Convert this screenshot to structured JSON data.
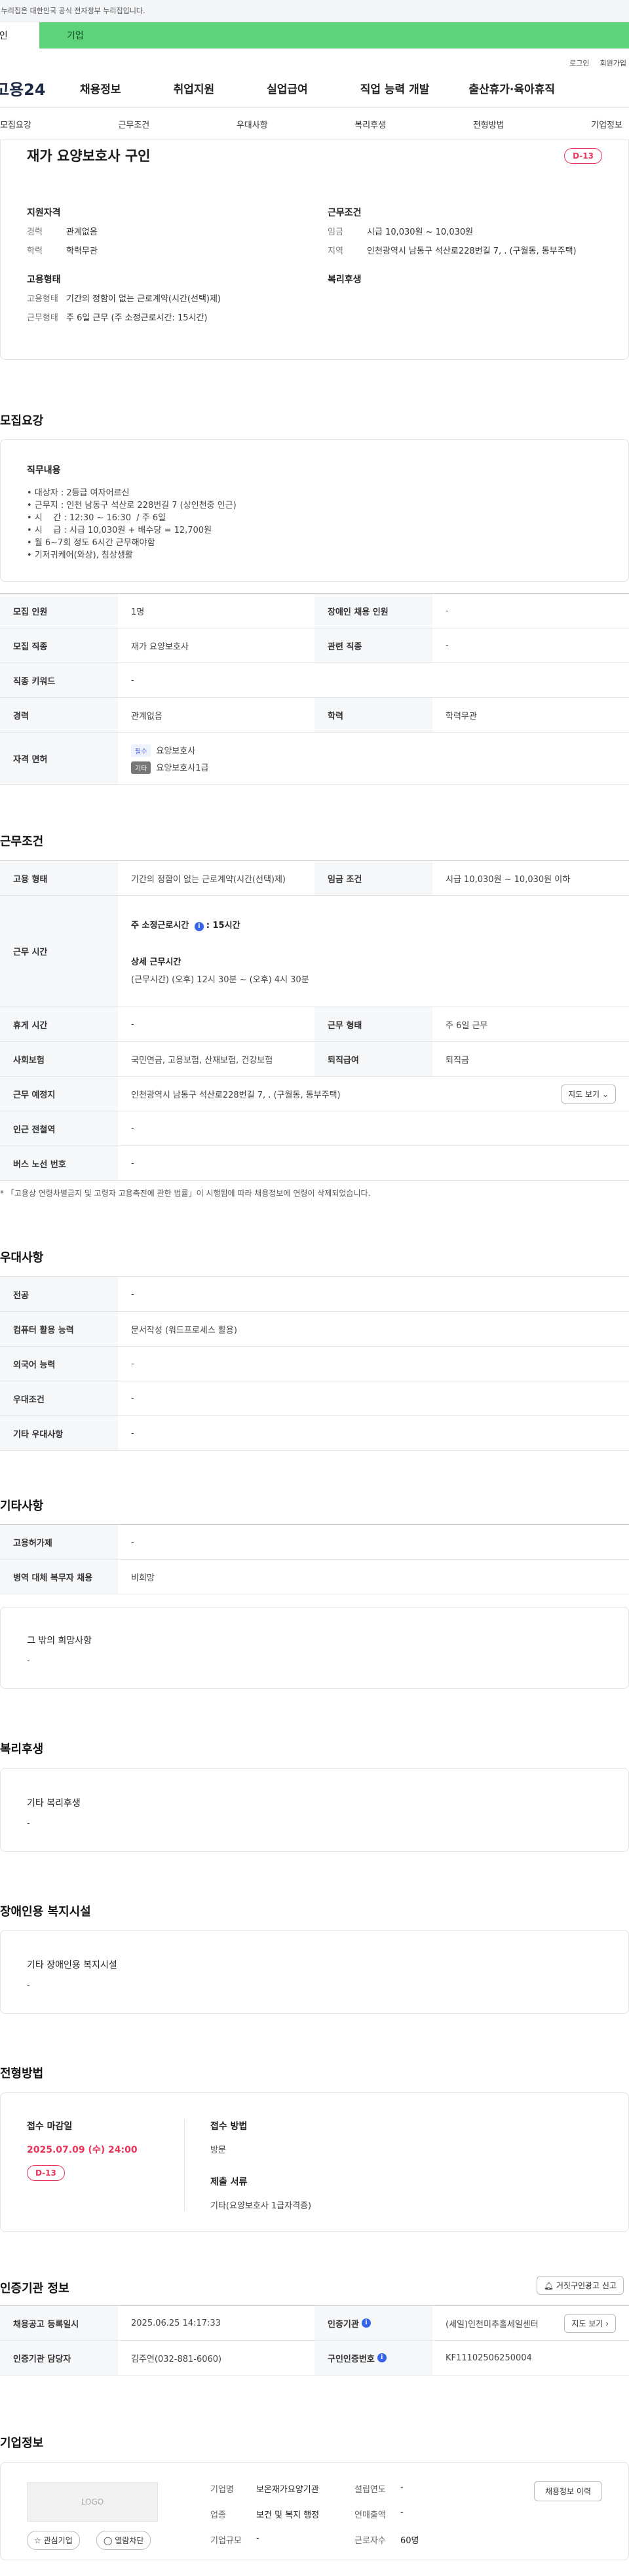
{
  "gov_notice": "이 누리집은 대한민국 공식 전자정부 누리집입니다.",
  "user_tabs": {
    "personal": "개인",
    "company": "기업"
  },
  "util_links": {
    "login": "로그인",
    "signup": "회원가입"
  },
  "logo": "고용24",
  "gnb": [
    "채용정보",
    "취업지원",
    "실업급여",
    "직업 능력 개발",
    "출산휴가·육아휴직"
  ],
  "anchor_tabs": [
    "모집요강",
    "근무조건",
    "우대사항",
    "복리후생",
    "전형방법",
    "기업정보"
  ],
  "summary": {
    "title": "재가 요양보호사 구인",
    "dday": "D-13",
    "qualification": {
      "heading": "지원자격",
      "rows": [
        {
          "k": "경력",
          "v": "관계없음"
        },
        {
          "k": "학력",
          "v": "학력무관"
        }
      ]
    },
    "conditions": {
      "heading": "근무조건",
      "rows": [
        {
          "k": "임금",
          "v": "시급 10,030원 ~ 10,030원"
        },
        {
          "k": "지역",
          "v": "인천광역시 남동구 석산로228번길 7, . (구월동, 동부주택)"
        }
      ]
    },
    "employment": {
      "heading": "고용형태",
      "rows": [
        {
          "k": "고용형태",
          "v": "기간의 정함이 없는 근로계약(시간(선택)제)"
        },
        {
          "k": "근무형태",
          "v": "주 6일 근무 (주 소정근로시간: 15시간)"
        }
      ]
    },
    "welfare": {
      "heading": "복리후생"
    }
  },
  "recruit": {
    "title": "모집요강",
    "duty_heading": "직무내용",
    "duty_lines": [
      "• 대상자 : 2등급 여자어르신",
      "• 근무지 : 인천 남동구 석산로 228번길 7 (상인천중 인근)",
      "• 시    간 : 12:30 ~ 16:30  / 주 6일",
      "• 시    급 : 시급 10,030원 + 배수당 = 12,700원",
      "• 월 6~7회 정도 6시간 근무해야함",
      "• 기저귀케어(와상), 침상생활"
    ],
    "table": {
      "headcount_label": "모집 인원",
      "headcount": "1명",
      "disabled_label": "장애인 채용 인원",
      "disabled": "-",
      "job_label": "모집 직종",
      "job": "재가 요양보호사",
      "related_label": "관련 직종",
      "related": "-",
      "keyword_label": "직종 키워드",
      "keyword": "-",
      "career_label": "경력",
      "career": "관계없음",
      "edu_label": "학력",
      "edu": "학력무관",
      "license_label": "자격 면허",
      "licenses": [
        {
          "tag": "필수",
          "name": "요양보호사"
        },
        {
          "tag": "기타",
          "name": "요양보호사1급"
        }
      ]
    }
  },
  "work": {
    "title": "근무조건",
    "type_label": "고용 형태",
    "type": "기간의 정함이 없는 근로계약(시간(선택)제)",
    "wage_label": "임금 조건",
    "wage": "시급 10,030원 ~ 10,030원 이하",
    "hours_label": "근무 시간",
    "weekly_hours_label": "주 소정근로시간",
    "weekly_hours": ": 15시간",
    "detail_hours_label": "상세 근무시간",
    "detail_hours": "(근무시간) (오후) 12시 30분 ~ (오후) 4시 30분",
    "rest_label": "휴게 시간",
    "rest": "-",
    "form_label": "근무 형태",
    "form": "주 6일 근무",
    "insurance_label": "사회보험",
    "insurance": "국민연금, 고용보험, 산재보험, 건강보험",
    "severance_label": "퇴직급여",
    "severance": "퇴직금",
    "place_label": "근무 예정지",
    "place": "인천광역시 남동구 석산로228번길 7, . (구월동, 동부주택)",
    "map_button": "지도 보기",
    "subway_label": "인근 전철역",
    "subway": "-",
    "bus_label": "버스 노선 번호",
    "bus": "-",
    "note": "* 「고용상 연령차별금지 및 고령자 고용촉진에 관한 법률」이 시행됨에 따라 채용정보에 연령이 삭제되었습니다."
  },
  "preference": {
    "title": "우대사항",
    "rows": [
      {
        "k": "전공",
        "v": "-"
      },
      {
        "k": "컴퓨터 활용 능력",
        "v": "문서작성 (워드프로세스 활용)"
      },
      {
        "k": "외국어 능력",
        "v": "-"
      },
      {
        "k": "우대조건",
        "v": "-"
      },
      {
        "k": "기타 우대사항",
        "v": "-"
      }
    ]
  },
  "etc": {
    "title": "기타사항",
    "rows": [
      {
        "k": "고용허가제",
        "v": "-"
      },
      {
        "k": "병역 대체 복무자 채용",
        "v": "비희망"
      }
    ],
    "other_heading": "그 밖의 희망사항",
    "other_value": "-"
  },
  "welfare": {
    "title": "복리후생",
    "heading": "기타 복리후생",
    "value": "-"
  },
  "disabled_facility": {
    "title": "장애인용 복지시설",
    "heading": "기타 장애인용 복지시설",
    "value": "-"
  },
  "selection": {
    "title": "전형방법",
    "deadline_heading": "접수 마감일",
    "deadline": "2025.07.09 (수) 24:00",
    "dday": "D-13",
    "method_heading": "접수 방법",
    "method": "방문",
    "docs_heading": "제출 서류",
    "docs": "기타(요양보호사 1급자격증)"
  },
  "agency": {
    "title": "인증기관 정보",
    "report_button": "거짓구인광고 신고",
    "reg_label": "채용공고 등록일시",
    "reg": "2025.06.25 14:17:33",
    "agency_label": "인증기관",
    "agency": "(세일)인천미추홀세일센터",
    "manager_label": "인증기관 담당자",
    "manager": "김주연(032-881-6060)",
    "number_label": "구인인증번호",
    "number": "KF11102506250004",
    "map_button": "지도 보기"
  },
  "company": {
    "title": "기업정보",
    "logo_placeholder": "LOGO",
    "fav_button": "관심기업",
    "block_button": "열람차단",
    "history_button": "채용정보 이력",
    "name_label": "기업명",
    "name": "보온재가요양기관",
    "year_label": "설립연도",
    "year": "-",
    "industry_label": "업종",
    "industry": "보건 및 복지 행정",
    "sales_label": "연매출액",
    "sales": "-",
    "size_label": "기업규모",
    "size": "-",
    "employees_label": "근로자수",
    "employees": "60명"
  }
}
